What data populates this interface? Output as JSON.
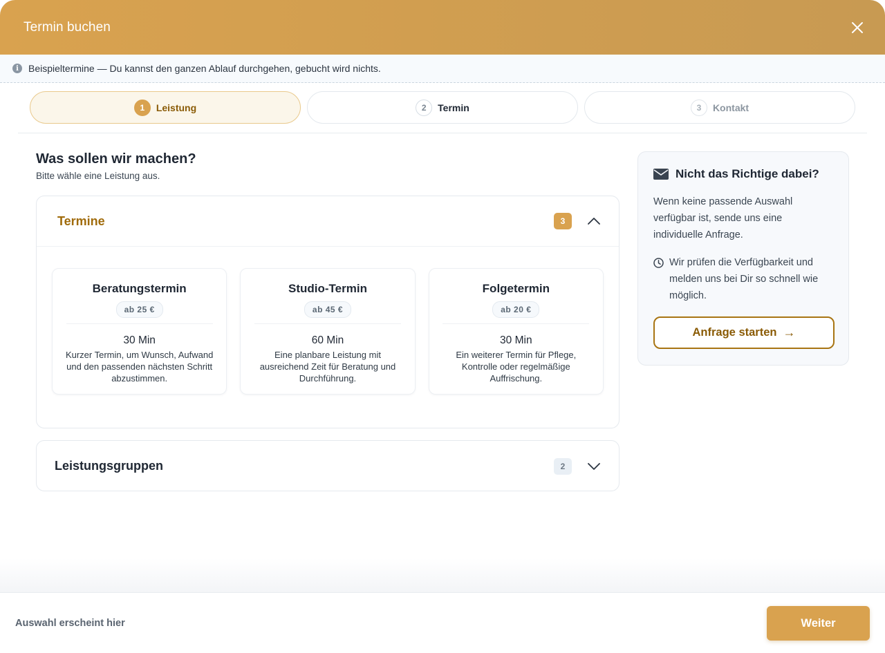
{
  "header": {
    "title": "Termin buchen"
  },
  "info": {
    "text": "Beispieltermine — Du kannst den ganzen Ablauf durchgehen, gebucht wird nichts."
  },
  "steps": [
    {
      "num": "1",
      "label": "Leistung"
    },
    {
      "num": "2",
      "label": "Termin"
    },
    {
      "num": "3",
      "label": "Kontakt"
    }
  ],
  "main": {
    "title": "Was sollen wir machen?",
    "subtitle": "Bitte wähle eine Leistung aus.",
    "accordions": [
      {
        "title": "Termine",
        "count": "3",
        "cards": [
          {
            "title": "Beratungstermin",
            "price": "ab 25 €",
            "duration": "30 Min",
            "description": "Kurzer Termin, um Wunsch, Aufwand und den passenden nächsten Schritt abzustimmen."
          },
          {
            "title": "Studio-Termin",
            "price": "ab 45 €",
            "duration": "60 Min",
            "description": "Eine planbare Leistung mit ausreichend Zeit für Beratung und Durchführung."
          },
          {
            "title": "Folgetermin",
            "price": "ab 20 €",
            "duration": "30 Min",
            "description": "Ein weiterer Termin für Pflege, Kontrolle oder regelmäßige Auffrischung."
          }
        ]
      },
      {
        "title": "Leistungsgruppen",
        "count": "2"
      }
    ]
  },
  "sidebar": {
    "title": "Nicht das Richtige dabei?",
    "text": "Wenn keine passende Auswahl verfügbar ist, sende uns eine individuelle Anfrage.",
    "note": "Wir prüfen die Verfügbarkeit und melden uns bei Dir so schnell wie möglich.",
    "cta": "Anfrage starten",
    "cta_arrow": "→"
  },
  "footer": {
    "selection_text": "Auswahl erscheint hier",
    "next_label": "Weiter"
  },
  "colors": {
    "accent": "#d9a24f",
    "accent_dark": "#8a5b06"
  }
}
